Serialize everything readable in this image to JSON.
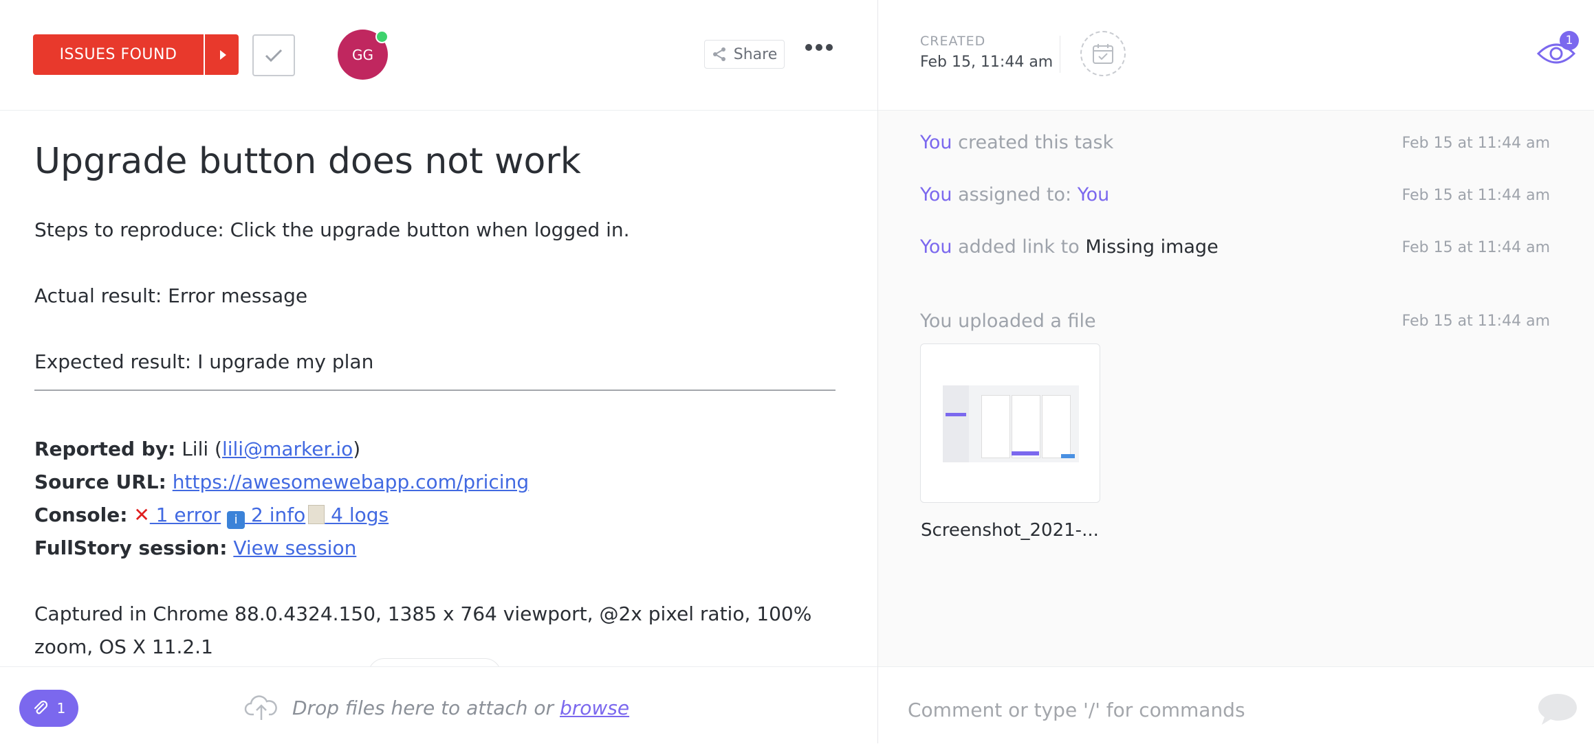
{
  "header": {
    "status_label": "ISSUES FOUND",
    "avatar_initials": "GG",
    "share_label": "Share"
  },
  "task": {
    "title": "Upgrade button does not work",
    "steps": "Steps to reproduce: Click the upgrade button when logged in.",
    "actual": "Actual result: Error message",
    "expected": "Expected result: I upgrade my plan",
    "reported_label": "Reported by:",
    "reported_name": " Lili (",
    "reported_email": "lili@marker.io",
    "reported_close": ")",
    "source_label": "Source URL:",
    "source_url": "https://awesomewebapp.com/pricing",
    "console_label": "Console:",
    "console_error": " 1 error",
    "console_info": " 2 info",
    "console_logs": " 4 logs ",
    "fullstory_label": "FullStory session:",
    "fullstory_link": "View session",
    "captured_line1": "Captured in Chrome 88.0.4324.150, 1385 x 764 viewport, @2x pixel ratio, 100%",
    "captured_line2": "zoom, OS X 11.2.1"
  },
  "attachments": {
    "count": "1",
    "drop_text": "Drop files here to attach or",
    "browse_label": "browse"
  },
  "meta": {
    "created_label": "CREATED",
    "created_date": "Feb 15, 11:44 am",
    "watchers_count": "1"
  },
  "activity": [
    {
      "actor": "You",
      "text": " created this task",
      "time": "Feb 15 at 11:44 am"
    },
    {
      "actor": "You",
      "text": " assigned to: ",
      "target": "You",
      "time": "Feb 15 at 11:44 am"
    },
    {
      "actor": "You",
      "text": " added link to ",
      "target": "Missing image",
      "time": "Feb 15 at 11:44 am"
    },
    {
      "text": "You uploaded a file",
      "time": "Feb 15 at 11:44 am"
    }
  ],
  "upload": {
    "file_name": "Screenshot_2021-..."
  },
  "comment": {
    "placeholder": "Comment or type '/' for commands"
  },
  "colors": {
    "status_red": "#e8392c",
    "accent_purple": "#7b68ee",
    "link_blue": "#4169e1",
    "avatar": "#c0275f"
  }
}
